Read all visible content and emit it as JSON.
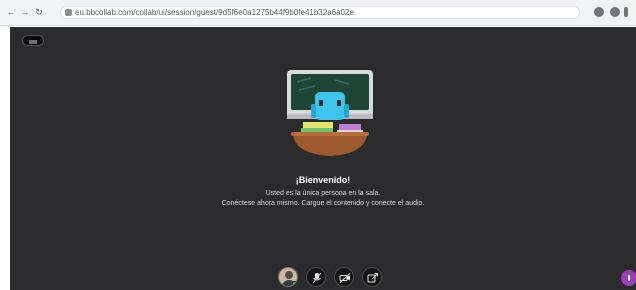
{
  "browser": {
    "url": "eu.bbcollab.com/collab/ui/session/guest/9d5f6e0a1275b44f9b0fe41b32a6a02e",
    "nav_buttons": [
      "back-icon",
      "forward-icon",
      "reload-icon"
    ],
    "toolbar_icons": [
      "extension-icon",
      "profile-icon",
      "menu-icon"
    ]
  },
  "session": {
    "welcome_title": "¡Bienvenido!",
    "description_line1": "Usted es la única persona en la sala.",
    "description_line2": "Conéctese ahora mismo. Cargue el contenido y conecte el audio."
  },
  "colors": {
    "background": "#2b2b2d",
    "chalkboard": "#1f4536",
    "robot": "#3ec4ec",
    "table": "#9c5a2e",
    "chat_accent": "#9a3fb8",
    "status_online": "#40c463"
  },
  "controls": {
    "items": [
      "avatar",
      "microphone-icon",
      "camera-icon",
      "share-content-icon"
    ]
  }
}
